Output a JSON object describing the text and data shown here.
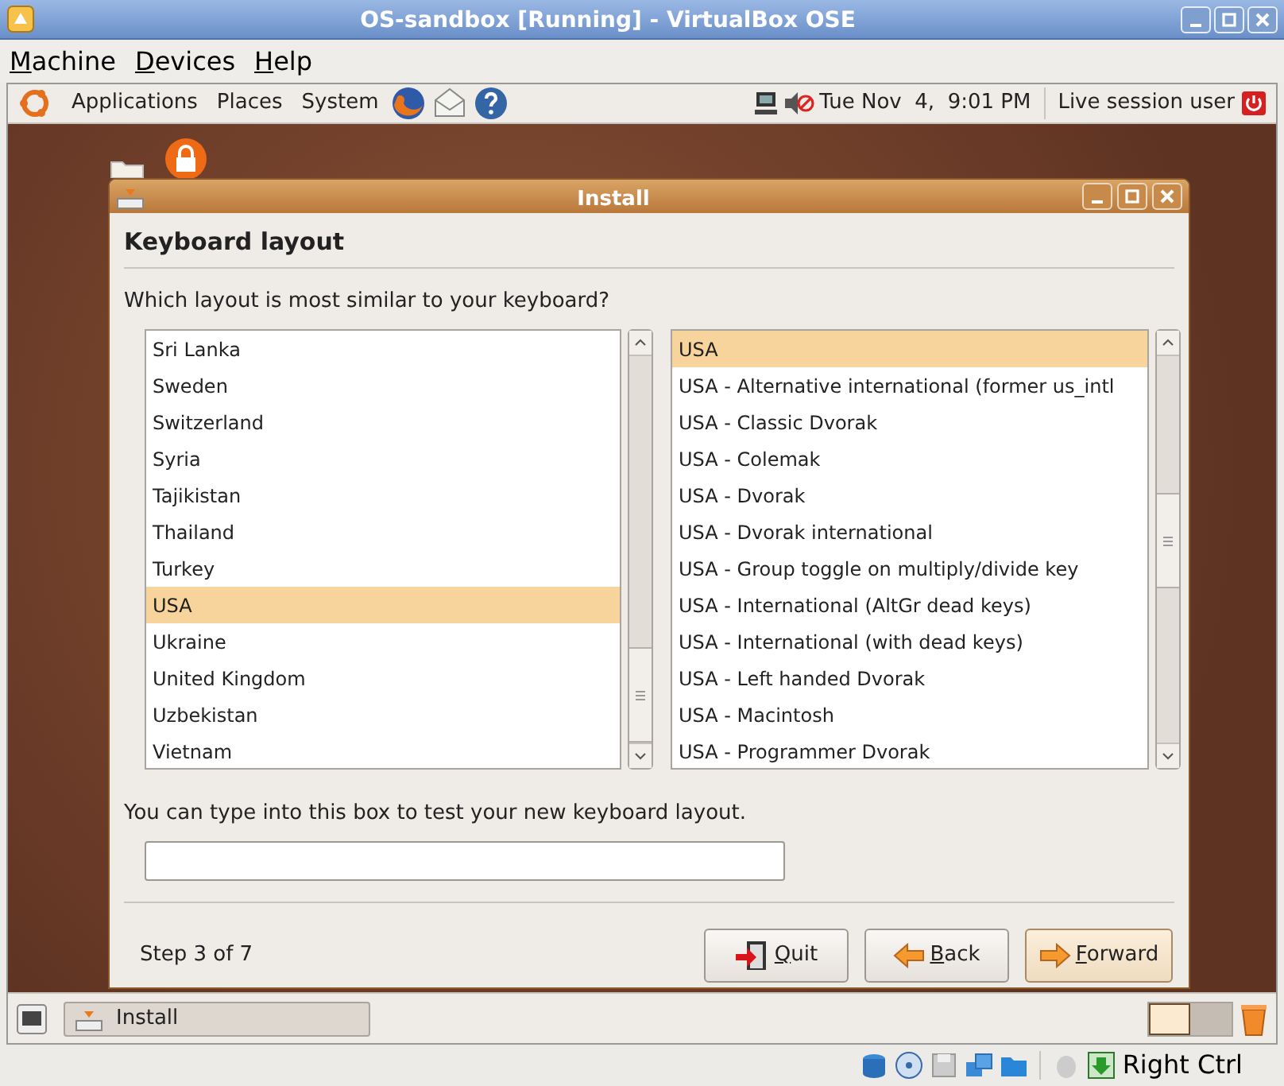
{
  "window": {
    "title": "OS-sandbox [Running] - VirtualBox OSE"
  },
  "menu": [
    "Machine",
    "Devices",
    "Help"
  ],
  "panel": {
    "menus": [
      "Applications",
      "Places",
      "System"
    ],
    "clock": "Tue Nov  4,  9:01 PM",
    "user": "Live session user"
  },
  "dialog": {
    "title": "Install",
    "heading": "Keyboard layout",
    "question": "Which layout is most similar to your keyboard?",
    "layouts": [
      {
        "label": "Sri Lanka",
        "selected": false
      },
      {
        "label": "Sweden",
        "selected": false
      },
      {
        "label": "Switzerland",
        "selected": false
      },
      {
        "label": "Syria",
        "selected": false
      },
      {
        "label": "Tajikistan",
        "selected": false
      },
      {
        "label": "Thailand",
        "selected": false
      },
      {
        "label": "Turkey",
        "selected": false
      },
      {
        "label": "USA",
        "selected": true
      },
      {
        "label": "Ukraine",
        "selected": false
      },
      {
        "label": "United Kingdom",
        "selected": false
      },
      {
        "label": "Uzbekistan",
        "selected": false
      },
      {
        "label": "Vietnam",
        "selected": false
      }
    ],
    "variants": [
      {
        "label": "USA",
        "selected": true
      },
      {
        "label": "USA - Alternative international (former us_intl",
        "selected": false
      },
      {
        "label": "USA - Classic Dvorak",
        "selected": false
      },
      {
        "label": "USA - Colemak",
        "selected": false
      },
      {
        "label": "USA - Dvorak",
        "selected": false
      },
      {
        "label": "USA - Dvorak international",
        "selected": false
      },
      {
        "label": "USA - Group toggle on multiply/divide key",
        "selected": false
      },
      {
        "label": "USA - International (AltGr dead keys)",
        "selected": false
      },
      {
        "label": "USA - International (with dead keys)",
        "selected": false
      },
      {
        "label": "USA - Left handed Dvorak",
        "selected": false
      },
      {
        "label": "USA - Macintosh",
        "selected": false
      },
      {
        "label": "USA - Programmer Dvorak",
        "selected": false
      }
    ],
    "test_label": "You can type into this box to test your new keyboard layout.",
    "step": "Step 3 of 7",
    "buttons": [
      {
        "label": "Quit",
        "kind": "quit",
        "focused": false
      },
      {
        "label": "Back",
        "kind": "back",
        "focused": false
      },
      {
        "label": "Forward",
        "kind": "forward",
        "focused": true
      }
    ]
  },
  "taskbar": [
    {
      "label": "Install"
    }
  ],
  "status": {
    "host_key": "Right Ctrl"
  }
}
